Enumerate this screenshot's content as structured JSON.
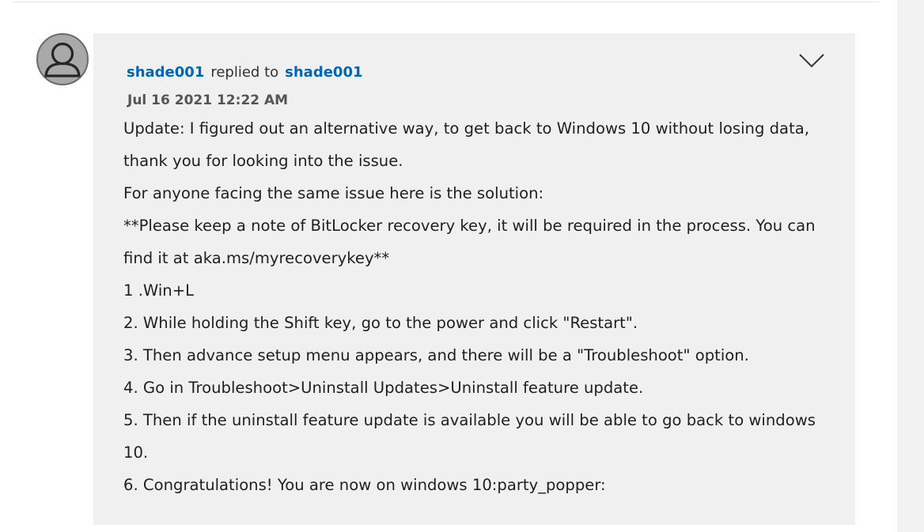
{
  "post": {
    "author": "shade001",
    "replied_to_text": "replied to",
    "reply_target": "shade001",
    "timestamp": "Jul 16 2021  12:22 AM",
    "lines": [
      "Update: I figured out an alternative way, to get back to Windows 10 without losing data, thank you for looking into the issue.",
      "For anyone facing the same issue here is the solution:",
      "**Please keep a note of BitLocker recovery key, it will be required in the process. You can find it at aka.ms/myrecoverykey**",
      "1 .Win+L",
      "2. While holding the Shift key, go to the power and click \"Restart\".",
      "3. Then advance setup menu appears, and there will be a \"Troubleshoot\" option.",
      "4. Go in Troubleshoot>Uninstall Updates>Uninstall feature update.",
      "5. Then if the uninstall feature update is available you will be able to go back to windows 10.",
      "6. Congratulations! You are now on windows 10:party_popper:"
    ]
  },
  "icons": {
    "avatar": "default-user-icon",
    "collapse": "chevron-down-icon"
  },
  "colors": {
    "link": "#0067b8",
    "card_background": "#f0f0f0",
    "avatar_background": "#a9a9a9"
  }
}
